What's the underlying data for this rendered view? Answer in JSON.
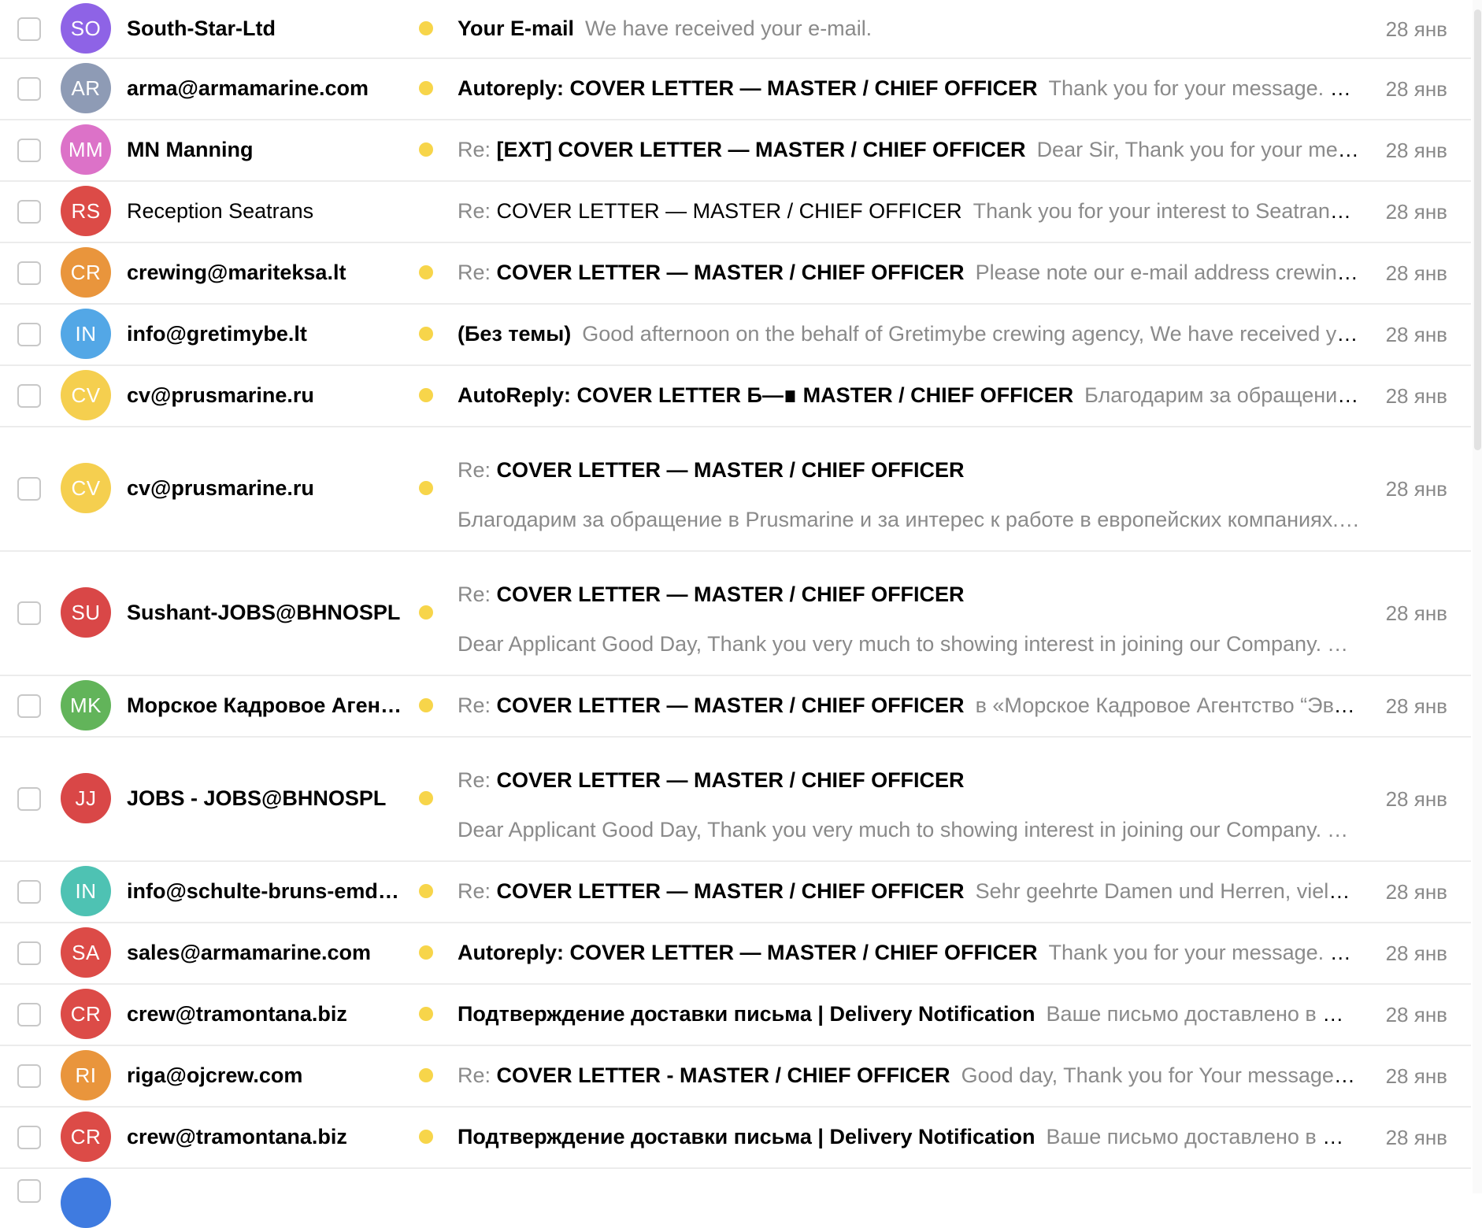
{
  "colors": {
    "unread_dot": "#f7d54a",
    "muted_text": "#8a8a8a",
    "divider": "#ececec"
  },
  "emails": [
    {
      "initials": "SO",
      "color": "#8e63e6",
      "sender": "South-Star-Ltd",
      "unread": true,
      "re": "",
      "subject": "Your E-mail",
      "snippet": "We have received your e-mail.",
      "snippet2": "",
      "date": "28 янв",
      "double": false
    },
    {
      "initials": "AR",
      "color": "#8e9bb5",
      "sender": "arma@armamarine.com",
      "unread": true,
      "re": "",
      "subject": "Autoreply: COVER LETTER — MASTER / CHIEF OFFICER",
      "snippet": "Thank you for your message. Subject…",
      "snippet2": "",
      "date": "28 янв",
      "double": false
    },
    {
      "initials": "MM",
      "color": "#dc72c8",
      "sender": "MN Manning",
      "unread": true,
      "re": "Re:",
      "subject": "[EXT] COVER LETTER — MASTER / CHIEF OFFICER",
      "snippet": "Dear Sir, Thank you for your message. …",
      "snippet2": "",
      "date": "28 янв",
      "double": false
    },
    {
      "initials": "RS",
      "color": "#dc4b47",
      "sender": "Reception Seatrans",
      "unread": false,
      "re": "Re:",
      "subject": "COVER LETTER — MASTER / CHIEF OFFICER",
      "snippet": "Thank you for your interest to Seatrans For p…",
      "snippet2": "",
      "date": "28 янв",
      "double": false
    },
    {
      "initials": "CR",
      "color": "#e9953c",
      "sender": "crewing@mariteksa.lt",
      "unread": true,
      "re": "Re:",
      "subject": "COVER LETTER — MASTER / CHIEF OFFICER",
      "snippet": "Please note our e-mail address crewing@ma…",
      "snippet2": "",
      "date": "28 янв",
      "double": false
    },
    {
      "initials": "IN",
      "color": "#53a7e6",
      "sender": "info@gretimybe.lt",
      "unread": true,
      "re": "",
      "subject": "(Без темы)",
      "snippet": "Good afternoon on the behalf of Gretimybe crewing agency, We have received your…",
      "snippet2": "",
      "date": "28 янв",
      "double": false
    },
    {
      "initials": "CV",
      "color": "#f5cf4f",
      "sender": "cv@prusmarine.ru",
      "unread": true,
      "re": "",
      "subject": "AutoReply: COVER LETTER Б—∎ MASTER / CHIEF OFFICER",
      "snippet": "Благодарим за обращение в Pru…",
      "snippet2": "",
      "date": "28 янв",
      "double": false
    },
    {
      "initials": "CV",
      "color": "#f5cf4f",
      "sender": "cv@prusmarine.ru",
      "unread": true,
      "re": "Re:",
      "subject": "COVER LETTER — MASTER / CHIEF OFFICER",
      "snippet": "Благодарим за обращение в Prusmarine и за интерес к работе в европейских компаниях.",
      "snippet2": "✓",
      "date": "28 янв",
      "double": true
    },
    {
      "initials": "SU",
      "color": "#d94747",
      "sender": "Sushant-JOBS@BHNOSPL",
      "unread": true,
      "re": "Re:",
      "subject": "COVER LETTER — MASTER / CHIEF OFFICER",
      "snippet": "Dear Applicant Good Day, Thank you very much to showing interest in joining our Company. You…",
      "snippet2": "",
      "date": "28 янв",
      "double": true
    },
    {
      "initials": "MK",
      "color": "#62b45a",
      "sender": "Морское Кадровое Агентство",
      "unread": true,
      "re": "Re:",
      "subject": "COVER LETTER — MASTER / CHIEF OFFICER",
      "snippet": "в «Морское Кадровое Агентство “Эверест…",
      "snippet2": "",
      "date": "28 янв",
      "double": false
    },
    {
      "initials": "JJ",
      "color": "#d94747",
      "sender": "JOBS - JOBS@BHNOSPL",
      "unread": true,
      "re": "Re:",
      "subject": "COVER LETTER — MASTER / CHIEF OFFICER",
      "snippet": "Dear Applicant Good Day, Thank you very much to showing interest in joining our Company. You…",
      "snippet2": "",
      "date": "28 янв",
      "double": true
    },
    {
      "initials": "IN",
      "color": "#4ec2b3",
      "sender": "info@schulte-bruns-emden.de",
      "unread": true,
      "re": "Re:",
      "subject": "COVER LETTER — MASTER / CHIEF OFFICER",
      "snippet": "Sehr geehrte Damen und Herren, vielen Dank…",
      "snippet2": "",
      "date": "28 янв",
      "double": false
    },
    {
      "initials": "SA",
      "color": "#dc4b47",
      "sender": "sales@armamarine.com",
      "unread": true,
      "re": "",
      "subject": "Autoreply: COVER LETTER — MASTER / CHIEF OFFICER",
      "snippet": "Thank you for your message. Subject…",
      "snippet2": "",
      "date": "28 янв",
      "double": false
    },
    {
      "initials": "CR",
      "color": "#dc4b47",
      "sender": "crew@tramontana.biz",
      "unread": true,
      "re": "",
      "subject": "Подтверждение доставки письма | Delivery Notification",
      "snippet": "Ваше письмо доставлено в Морск…",
      "snippet2": "",
      "date": "28 янв",
      "double": false
    },
    {
      "initials": "RI",
      "color": "#e9953c",
      "sender": "riga@ojcrew.com",
      "unread": true,
      "re": "Re:",
      "subject": "COVER LETTER - MASTER / CHIEF OFFICER",
      "snippet": "Good day, Thank you for Your message which …",
      "snippet2": "",
      "date": "28 янв",
      "double": false
    },
    {
      "initials": "CR",
      "color": "#dc4b47",
      "sender": "crew@tramontana.biz",
      "unread": true,
      "re": "",
      "subject": "Подтверждение доставки письма | Delivery Notification",
      "snippet": "Ваше письмо доставлено в Морск…",
      "snippet2": "",
      "date": "28 янв",
      "double": false
    }
  ]
}
